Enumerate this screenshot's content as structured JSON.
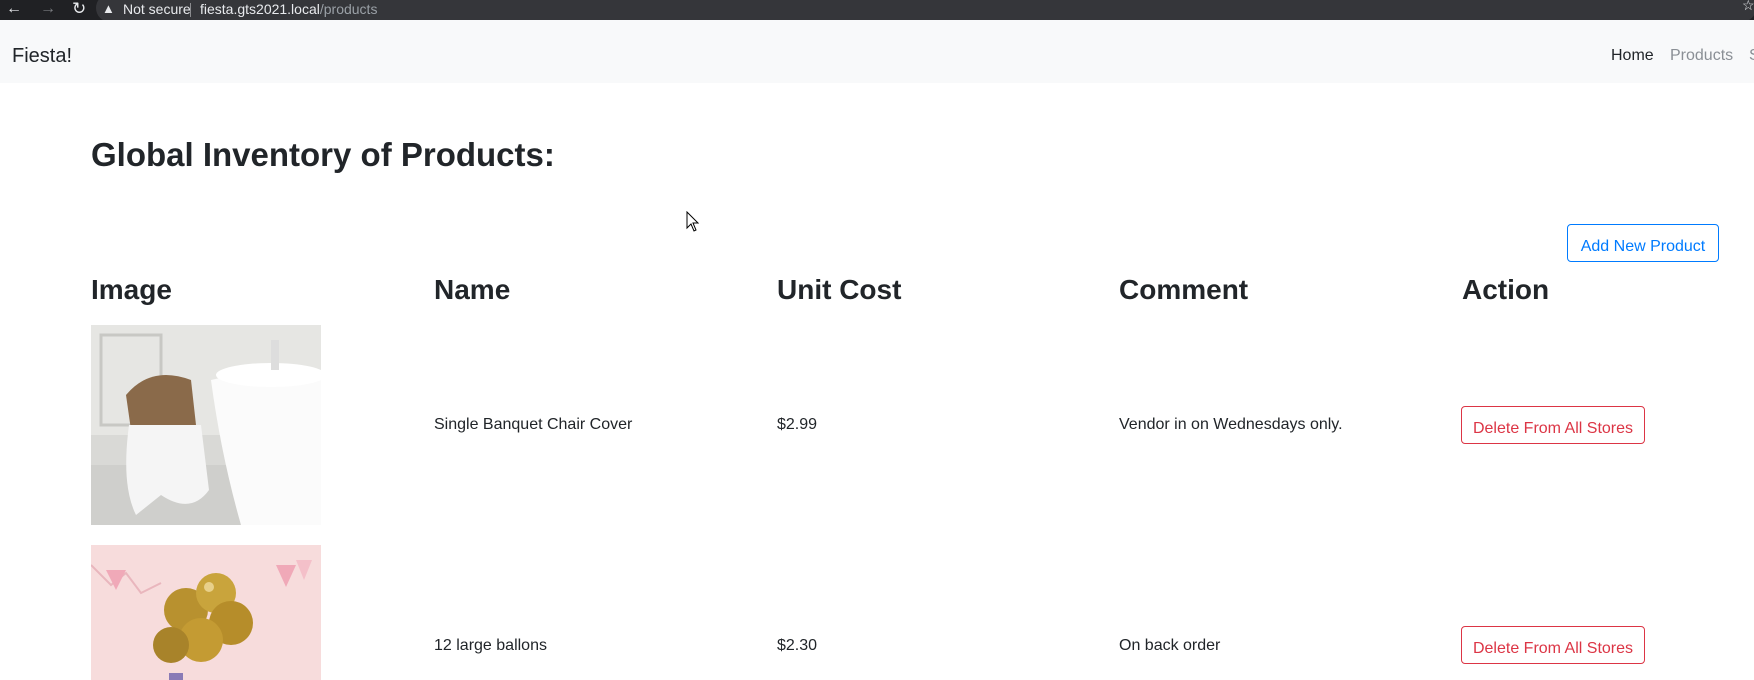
{
  "browser": {
    "back_icon": "back-arrow-icon",
    "forward_icon": "forward-arrow-icon",
    "reload_icon": "reload-icon",
    "security_label": "Not secure",
    "url_host": "fiesta.gts2021.local",
    "url_path": "/products"
  },
  "navbar": {
    "brand": "Fiesta!",
    "links": [
      {
        "label": "Home"
      },
      {
        "label": "Products"
      },
      {
        "label": "S"
      }
    ]
  },
  "page": {
    "title": "Global Inventory of Products:",
    "add_button": "Add New Product"
  },
  "table": {
    "headers": [
      "Image",
      "Name",
      "Unit Cost",
      "Comment",
      "Action"
    ],
    "rows": [
      {
        "image": "chair-cover-photo",
        "name": "Single Banquet Chair Cover",
        "unit_cost": "$2.99",
        "comment": "Vendor in on Wednesdays only.",
        "action": "Delete From All Stores"
      },
      {
        "image": "gold-balloons-photo",
        "name": "12 large ballons",
        "unit_cost": "$2.30",
        "comment": "On back order",
        "action": "Delete From All Stores"
      }
    ]
  },
  "colors": {
    "primary": "#007bff",
    "danger": "#dc3545",
    "navbar_bg": "#f8f9fa",
    "chrome_bg": "#202124"
  }
}
